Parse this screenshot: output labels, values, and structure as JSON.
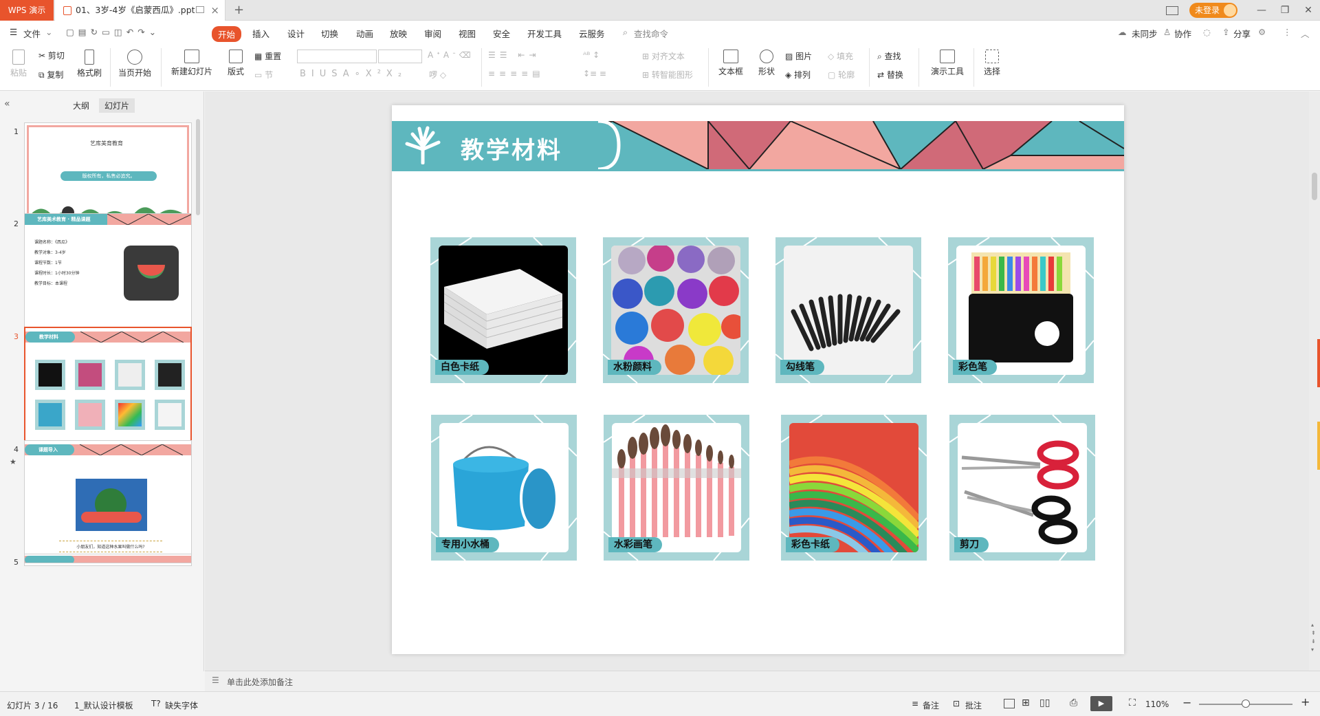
{
  "app": {
    "name": "WPS 演示",
    "doc_tab": "01、3岁-4岁《启蒙西瓜》.ppt",
    "login": "未登录"
  },
  "menu": {
    "items": [
      "文件",
      "开始",
      "插入",
      "设计",
      "切换",
      "动画",
      "放映",
      "审阅",
      "视图",
      "安全",
      "开发工具",
      "云服务"
    ],
    "search": "查找命令",
    "right": [
      "未同步",
      "协作",
      "分享"
    ]
  },
  "toolbar": {
    "paste": "粘贴",
    "cut": "剪切",
    "copy": "复制",
    "format_painter": "格式刷",
    "from_current": "当页开始",
    "new_slide": "新建幻灯片",
    "layout": "版式",
    "reset": "重置",
    "section": "节",
    "align_text": "对齐文本",
    "smart_art": "转智能图形",
    "textbox": "文本框",
    "shape": "形状",
    "picture": "图片",
    "arrange": "排列",
    "fill": "填充",
    "outline": "轮廓",
    "find": "查找",
    "replace": "替换",
    "present_tools": "演示工具",
    "select": "选择"
  },
  "panel": {
    "tabs": [
      "大纲",
      "幻灯片"
    ],
    "active_tab": "幻灯片",
    "thumbs": [
      {
        "num": "1",
        "title": "艺库美育教育",
        "banner": "版权所有，私售必追究。"
      },
      {
        "num": "2",
        "title": "艺库美术教育 · 精品课题",
        "lines": [
          "课题名称：《西瓜》",
          "教学对象：3-4岁",
          "课程节数：1节",
          "课程时长：1小时30分钟",
          "教学目标：本课程"
        ]
      },
      {
        "num": "3",
        "title": "教学材料"
      },
      {
        "num": "4",
        "title": "课题导入",
        "caption": "小朋友们，知道这种水果叫做什么吗?"
      },
      {
        "num": "5"
      }
    ]
  },
  "slide": {
    "title": "教学材料",
    "materials": [
      "白色卡纸",
      "水粉颜料",
      "勾线笔",
      "彩色笔",
      "专用小水桶",
      "水彩画笔",
      "彩色卡纸",
      "剪刀"
    ]
  },
  "notes": {
    "placeholder": "单击此处添加备注"
  },
  "status": {
    "slide_info": "幻灯片 3 / 16",
    "template": "1_默认设计模板",
    "missing_font": "缺失字体",
    "notes_btn": "备注",
    "comment_btn": "批注",
    "zoom": "110%"
  },
  "colors": {
    "accent": "#e8542c",
    "teal": "#5eb7be",
    "light_teal": "#a9d5d7",
    "pink": "#f2a7a0",
    "rose": "#d06a78"
  }
}
